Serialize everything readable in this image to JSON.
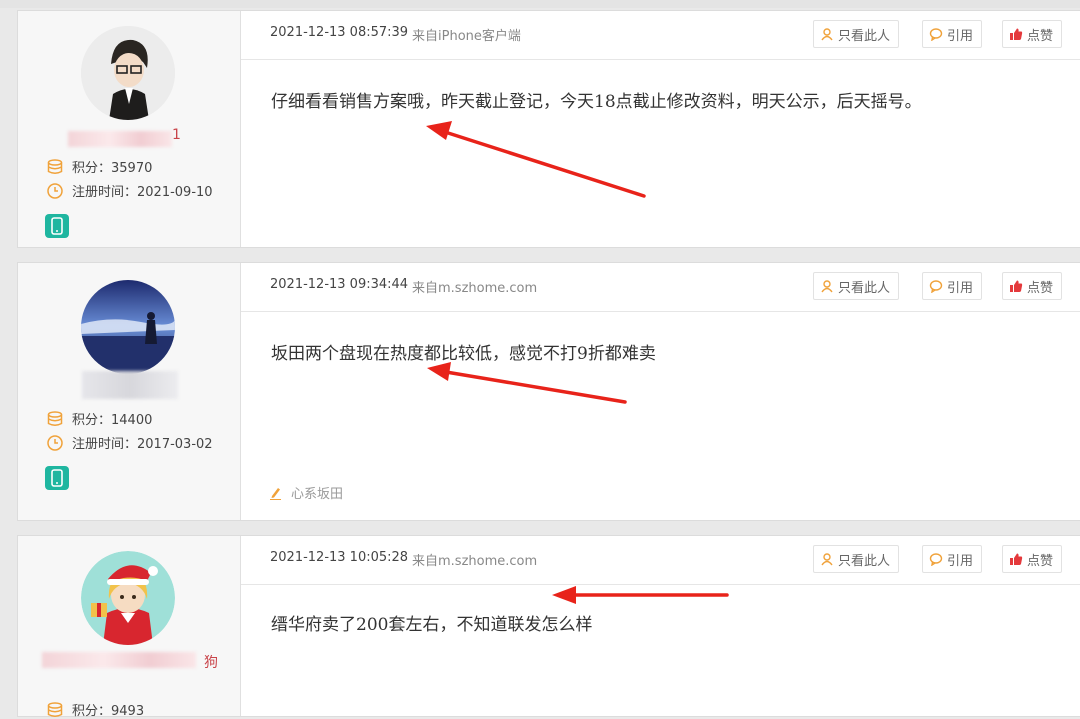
{
  "actions": {
    "only_author": "只看此人",
    "quote": "引用",
    "like": "点赞"
  },
  "posts": [
    {
      "user": {
        "name_tail": "1",
        "points": "积分：35970",
        "registered": "注册时间：2021-09-10"
      },
      "time": "2021-12-13 08:57:39",
      "source": "来自iPhone客户端",
      "content": "仔细看看销售方案哦，昨天截止登记，今天18点截止修改资料，明天公示，后天摇号。"
    },
    {
      "user": {
        "name_tail": "",
        "points": "积分：14400",
        "registered": "注册时间：2017-03-02"
      },
      "time": "2021-12-13 09:34:44",
      "source": "来自m.szhome.com",
      "content": "坂田两个盘现在热度都比较低，感觉不打9折都难卖",
      "tag": "心系坂田"
    },
    {
      "user": {
        "name_tail": "狗",
        "points": "积分：9493",
        "registered": ""
      },
      "time": "2021-12-13 10:05:28",
      "source": "来自m.szhome.com",
      "content": "缙华府卖了200套左右，不知道联发怎么样"
    }
  ],
  "colors": {
    "accent": "#f0a23a",
    "like": "#e4393c",
    "badge": "#1fb6a0",
    "arrow": "#e8231a"
  }
}
